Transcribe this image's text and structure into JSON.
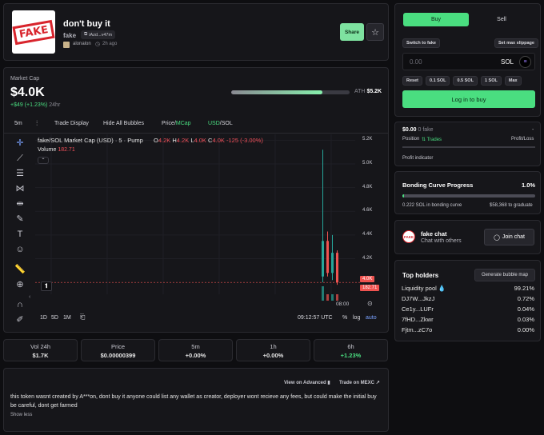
{
  "token": {
    "name": "don't buy it",
    "ticker": "fake",
    "address_short": "iAzd...v47m",
    "creator": "alonalon",
    "age": "2h ago",
    "image_text": "FAKE"
  },
  "header_actions": {
    "share": "Share",
    "star_icon": "star-icon"
  },
  "market": {
    "label": "Market Cap",
    "value": "$4.0K",
    "change": "+$49 (+1.23%)",
    "period": "24hr",
    "ath_label": "ATH",
    "ath_value": "$5.2K",
    "ath_progress": 0.77
  },
  "chart_toolbar": {
    "interval": "5m",
    "trade_display": "Trade Display",
    "hide_bubbles": "Hide All Bubbles",
    "price": "Price",
    "sep": "/",
    "mcap": "MCap",
    "usd": "USD",
    "sol": "SOL"
  },
  "chart_legend": {
    "title": "fake/SOL Market Cap (USD) · 5 · Pump",
    "o_label": "O",
    "o": "4.2K",
    "h_label": "H",
    "h": "4.2K",
    "l_label": "L",
    "l": "4.0K",
    "c_label": "C",
    "c": "4.0K",
    "chg": "-125 (-3.00%)",
    "volume_label": "Volume",
    "volume": "182.71"
  },
  "chart_axis": {
    "ticks": [
      "5.2K",
      "5.0K",
      "4.8K",
      "4.6K",
      "4.4K",
      "4.2K"
    ],
    "price_badge": "4.0K",
    "volume_badge": "182.71",
    "time_tick": "08:00",
    "clock": "09:12:57 UTC",
    "pct": "%",
    "log": "log",
    "auto": "auto",
    "ranges": [
      "1D",
      "5D",
      "1M"
    ]
  },
  "chart_data": {
    "type": "candlestick",
    "title": "fake/SOL Market Cap (USD) · 5 · Pump",
    "y_ticks": [
      5200,
      5000,
      4800,
      4600,
      4400,
      4200
    ],
    "ylim": [
      3900,
      5250
    ],
    "candles": [
      {
        "o": 4050,
        "h": 5120,
        "l": 4000,
        "c": 4350,
        "dir": "up"
      },
      {
        "o": 4350,
        "h": 4430,
        "l": 4050,
        "c": 4080,
        "dir": "down"
      },
      {
        "o": 4080,
        "h": 4400,
        "l": 4020,
        "c": 4250,
        "dir": "up"
      },
      {
        "o": 4250,
        "h": 4270,
        "l": 3980,
        "c": 4000,
        "dir": "down"
      }
    ],
    "last_value": 4000,
    "volume": 182.71
  },
  "stats": [
    {
      "label": "Vol 24h",
      "value": "$1.7K",
      "color": "#e6e6e6"
    },
    {
      "label": "Price",
      "value": "$0.00000399",
      "color": "#e6e6e6"
    },
    {
      "label": "5m",
      "value": "+0.00%",
      "color": "#e6e6e6"
    },
    {
      "label": "1h",
      "value": "+0.00%",
      "color": "#e6e6e6"
    },
    {
      "label": "6h",
      "value": "+1.23%",
      "color": "#4ade80"
    }
  ],
  "description": {
    "view_advanced": "View on Advanced",
    "trade_mexc": "Trade on MEXC",
    "text": "this token wasnt created by A***on, dont buy it anyone could list any wallet as creator, deployer wont recieve any fees, but could make the initial buy be careful, dont get farmed",
    "show_less": "Show less"
  },
  "trade": {
    "buy_tab": "Buy",
    "sell_tab": "Sell",
    "switch": "Switch to fake",
    "slippage": "Set max slippage",
    "amount_placeholder": "0.00",
    "currency": "SOL",
    "quick": [
      "Reset",
      "0.1 SOL",
      "0.5 SOL",
      "1 SOL",
      "Max"
    ],
    "login": "Log in to buy"
  },
  "position": {
    "value": "$0.00",
    "amount": "0 fake",
    "dash": "-",
    "position_label": "Position",
    "trades": "Trades",
    "pnl_label": "Profit/Loss",
    "indicator": "Profit indicator"
  },
  "bonding": {
    "title": "Bonding Curve Progress",
    "pct": "1.0%",
    "progress": 0.01,
    "sol_in": "0.222 SOL in bonding curve",
    "to_graduate": "$58,368 to graduate"
  },
  "chat": {
    "title": "fake chat",
    "subtitle": "Chat with others",
    "join": "Join chat"
  },
  "holders": {
    "title": "Top holders",
    "bubble_map": "Generate bubble map",
    "rows": [
      {
        "name": "Liquidity pool 💧",
        "pct": "99.21%"
      },
      {
        "name": "DJ7W...JkzJ",
        "pct": "0.72%"
      },
      {
        "name": "Ce1y...LUFr",
        "pct": "0.04%"
      },
      {
        "name": "7fHD...Zkwr",
        "pct": "0.03%"
      },
      {
        "name": "Fjtm...zC7o",
        "pct": "0.00%"
      }
    ]
  },
  "colors": {
    "accent": "#4ade80",
    "up": "#26a69a",
    "down": "#ef5350",
    "bg": "#0e0e11"
  }
}
